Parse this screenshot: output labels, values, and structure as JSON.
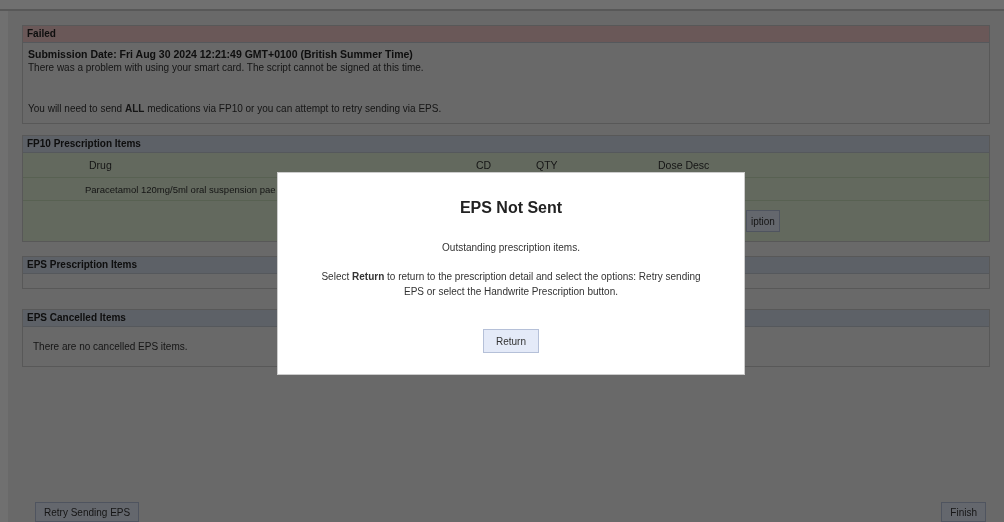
{
  "status_panel": {
    "title": "Failed",
    "submission_date": "Submission Date:  Fri Aug 30 2024 12:21:49 GMT+0100 (British Summer Time)",
    "messages": [
      "There was a problem with using your smart card. The script cannot be signed at this time.",
      "You will need to send **ALL** medications via FP10 or you can attempt to retry sending via EPS."
    ]
  },
  "fp10_items": {
    "title": "FP10 Prescription Items",
    "columns": [
      "Drug",
      "CD",
      "QTY",
      "Dose Desc"
    ],
    "rows": [
      {
        "drug": "Paracetamol 120mg/5ml oral suspension pae"
      }
    ],
    "button": "iption"
  },
  "eps_items": {
    "title": "EPS Prescription Items"
  },
  "eps_cancelled": {
    "title": "EPS Cancelled Items",
    "message": "There are no cancelled EPS items."
  },
  "footer": {
    "left_button": "Retry Sending EPS",
    "right_button": "Finish"
  },
  "dialog": {
    "title": "EPS Not Sent",
    "messages": [
      "Outstanding prescription items.",
      "Select **Return** to return to the prescription detail and select the options: Retry sending EPS or select the Handwrite Prescription button."
    ],
    "button": "Return"
  }
}
